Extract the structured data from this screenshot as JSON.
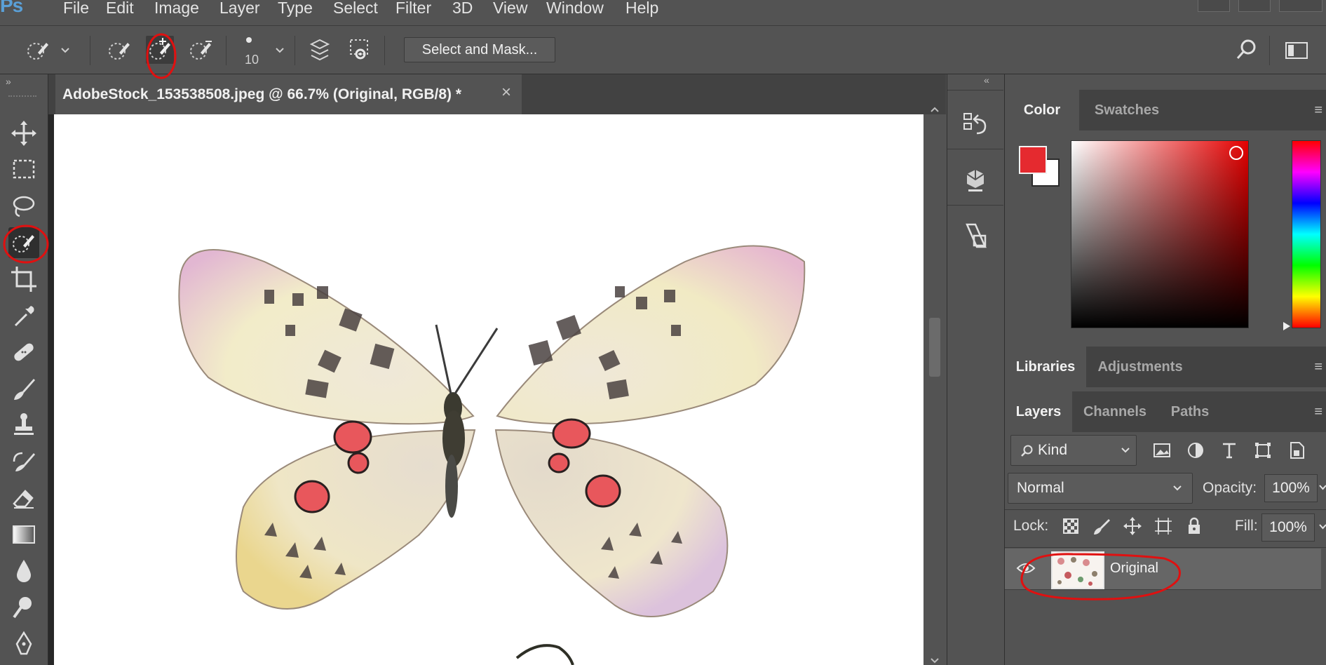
{
  "app": {
    "logo": "Ps"
  },
  "menu": [
    "File",
    "Edit",
    "Image",
    "Layer",
    "Type",
    "Select",
    "Filter",
    "3D",
    "View",
    "Window",
    "Help"
  ],
  "options_bar": {
    "brush_size": "10",
    "select_and_mask_label": "Select and Mask..."
  },
  "document": {
    "tab_title": "AdobeStock_153538508.jpeg @ 66.7% (Original, RGB/8) *",
    "close_glyph": "×"
  },
  "color_panel": {
    "tabs": [
      "Color",
      "Swatches"
    ],
    "foreground_color": "#e52a2f",
    "background_color": "#ffffff",
    "hue_color": "#e50000"
  },
  "libraries_panel": {
    "tabs": [
      "Libraries",
      "Adjustments"
    ]
  },
  "layers_panel": {
    "tabs": [
      "Layers",
      "Channels",
      "Paths"
    ],
    "filter_label": "Kind",
    "blend_mode": "Normal",
    "opacity_label": "Opacity:",
    "opacity_value": "100%",
    "lock_label": "Lock:",
    "fill_label": "Fill:",
    "fill_value": "100%",
    "layers": [
      {
        "name": "Original",
        "visible": true
      }
    ]
  },
  "annotations": {
    "color": "#e01010"
  },
  "icons": {
    "tools": [
      "move-icon",
      "marquee-icon",
      "lasso-icon",
      "quick-selection-icon",
      "crop-icon",
      "eyedropper-icon",
      "healing-brush-icon",
      "brush-icon",
      "stamp-icon",
      "history-brush-icon",
      "eraser-icon",
      "gradient-icon",
      "blur-icon",
      "dodge-icon",
      "pen-icon"
    ]
  }
}
